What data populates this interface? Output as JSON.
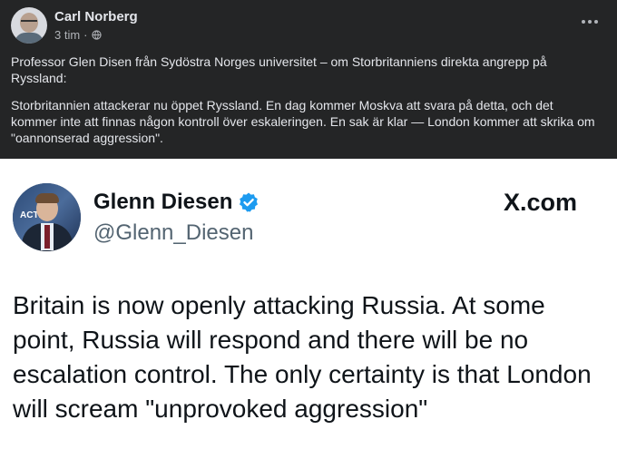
{
  "facebook_post": {
    "author": "Carl Norberg",
    "time": "3 tim",
    "separator": "·",
    "paragraph1": "Professor Glen Disen från Sydöstra Norges universitet – om Storbritanniens direkta angrepp på Ryssland:",
    "paragraph2": "Storbritannien attackerar nu öppet Ryssland. En dag kommer Moskva att svara på detta, och det kommer inte att finnas någon kontroll över eskaleringen. En sak är klar — London kommer att skrika om \"oannonserad aggression\"."
  },
  "tweet": {
    "name": "Glenn Diesen",
    "handle": "@Glenn_Diesen",
    "platform": "X.com",
    "text": "Britain is now openly attacking Russia. At some point, Russia will respond and there will be no escalation control. The only certainty is that London will scream \"unprovoked aggression\""
  },
  "colors": {
    "fb_background": "#242526",
    "fb_text": "#e4e6eb",
    "fb_secondary": "#b0b3b8",
    "x_verified": "#1d9bf0",
    "x_handle": "#536471"
  }
}
